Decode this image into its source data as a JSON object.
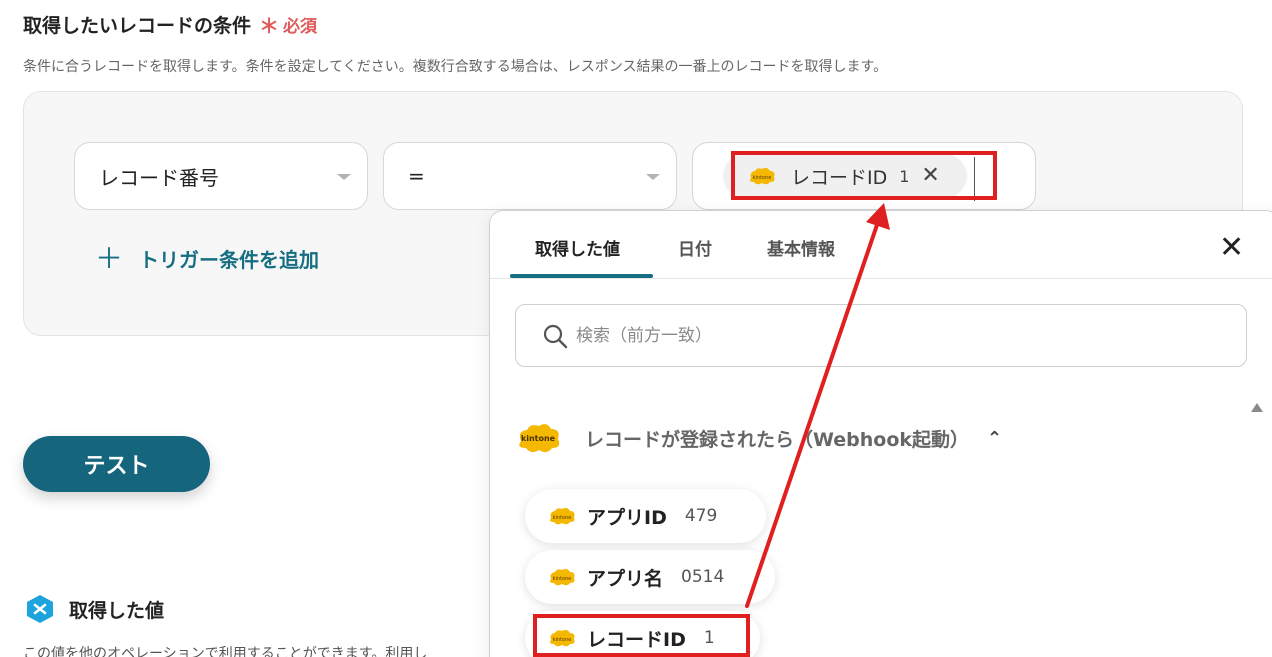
{
  "header": {
    "title": "取得したいレコードの条件",
    "required_mark": "＊",
    "required_label": "必須",
    "description": "条件に合うレコードを取得します。条件を設定してください。複数行合致する場合は、レスポンス結果の一番上のレコードを取得します。"
  },
  "condition": {
    "field_select": "レコード番号",
    "operator_select": "=",
    "value_chip": {
      "label": "レコードID",
      "value": "1"
    },
    "add_condition_label": "トリガー条件を追加"
  },
  "test_button": {
    "label": "テスト"
  },
  "result": {
    "title": "取得した値",
    "description": "この値を他のオペレーションで利用することができます。利用し"
  },
  "picker": {
    "tabs": [
      {
        "label": "取得した値",
        "active": true
      },
      {
        "label": "日付",
        "active": false
      },
      {
        "label": "基本情報",
        "active": false
      }
    ],
    "search_placeholder": "検索（前方一致）",
    "group_title": "レコードが登録されたら（Webhook起動）",
    "items": [
      {
        "label": "アプリID",
        "value": "479"
      },
      {
        "label": "アプリ名",
        "value": "0514"
      },
      {
        "label": "レコードID",
        "value": "1"
      }
    ]
  },
  "colors": {
    "accent": "#15657c",
    "required": "#e05a5a",
    "highlight": "#e02020",
    "kintone": "#f5b800"
  },
  "icons": [
    "kintone-logo-icon",
    "close-icon",
    "search-icon",
    "plus-icon",
    "chevron-up-icon",
    "yoom-value-icon",
    "scroll-up-icon"
  ]
}
